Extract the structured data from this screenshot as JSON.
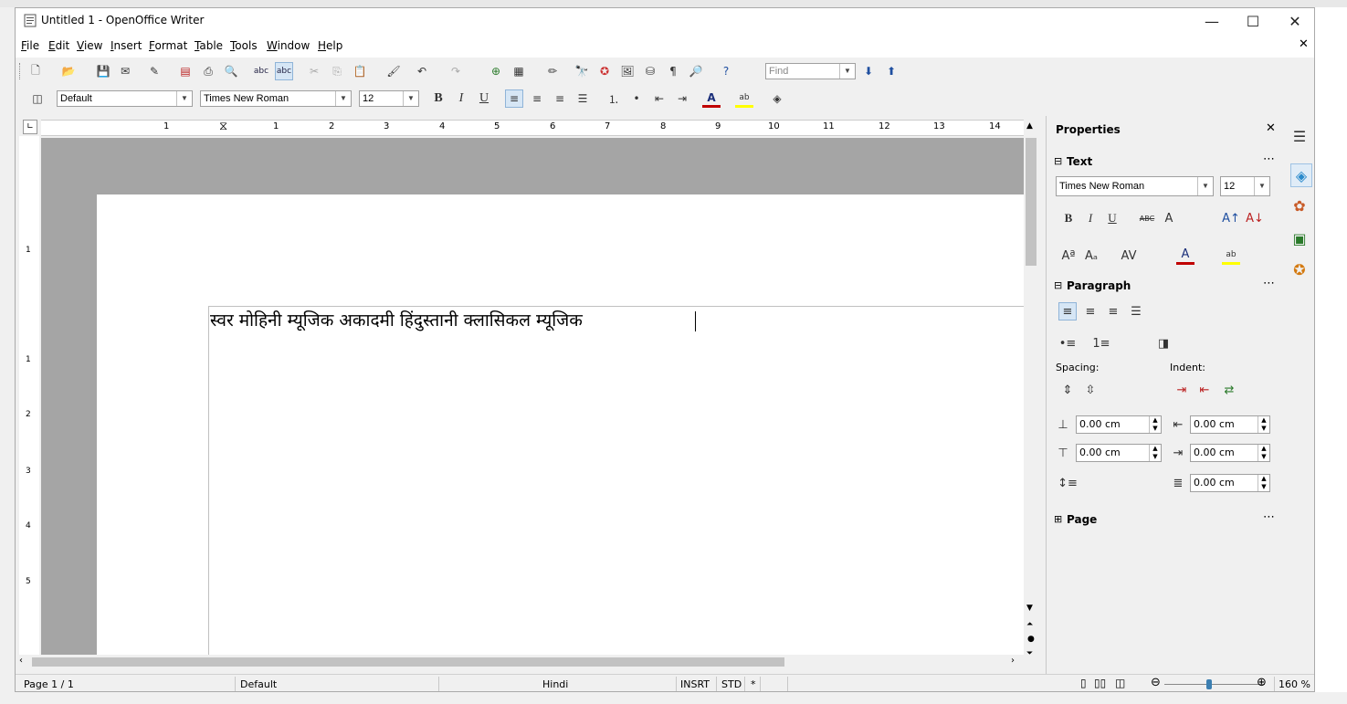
{
  "window": {
    "title": "Untitled 1 - OpenOffice Writer",
    "minimize_glyph": "—",
    "maximize_glyph": "☐",
    "close_glyph": "✕",
    "menubar_close_glyph": "✕"
  },
  "menu": [
    {
      "label": "File",
      "accel": "F",
      "rest": "ile"
    },
    {
      "label": "Edit",
      "accel": "E",
      "rest": "dit"
    },
    {
      "label": "View",
      "accel": "V",
      "rest": "iew"
    },
    {
      "label": "Insert",
      "accel": "I",
      "rest": "nsert"
    },
    {
      "label": "Format",
      "accel": "F",
      "rest": "ormat"
    },
    {
      "label": "Table",
      "accel": "T",
      "rest": "able"
    },
    {
      "label": "Tools",
      "accel": "T",
      "rest": "ools"
    },
    {
      "label": "Window",
      "accel": "W",
      "rest": "indow"
    },
    {
      "label": "Help",
      "accel": "H",
      "rest": "elp"
    }
  ],
  "standard_toolbar": {
    "find_placeholder": "Find"
  },
  "formatting_toolbar": {
    "paragraph_style": "Default",
    "font_name": "Times New Roman",
    "font_size": "12",
    "bold": "B",
    "italic": "I",
    "underline": "U"
  },
  "ruler": {
    "labels": [
      "1",
      "1",
      "2",
      "3",
      "4",
      "5",
      "6",
      "7",
      "8",
      "9",
      "10",
      "11",
      "12",
      "13",
      "14"
    ],
    "vlabels": [
      "1",
      "1",
      "2",
      "3",
      "4",
      "5"
    ]
  },
  "document": {
    "text": "स्वर मोहिनी म्यूजिक अकादमी हिंदुस्तानी क्लासिकल म्यूजिक"
  },
  "sidebar": {
    "title": "Properties",
    "text_section": "Text",
    "font_name": "Times New Roman",
    "font_size": "12",
    "paragraph_section": "Paragraph",
    "spacing_label": "Spacing:",
    "indent_label": "Indent:",
    "above_spacing": "0.00 cm",
    "below_spacing": "0.00 cm",
    "before_indent": "0.00 cm",
    "after_indent": "0.00 cm",
    "first_line_indent": "0.00 cm",
    "page_section": "Page",
    "more_glyph": "⋯",
    "collapse_glyph": "⊟",
    "expand_glyph": "⊞"
  },
  "status": {
    "page": "Page 1 / 1",
    "style": "Default",
    "language": "Hindi",
    "insert_mode": "INSRT",
    "selection_mode": "STD",
    "modified": "*",
    "zoom": "160 %"
  },
  "colors": {
    "accent": "#3c7fb1",
    "doc_background": "#a5a5a5",
    "font_color_bar": "#c00000",
    "highlight_bar": "#ffff00"
  }
}
